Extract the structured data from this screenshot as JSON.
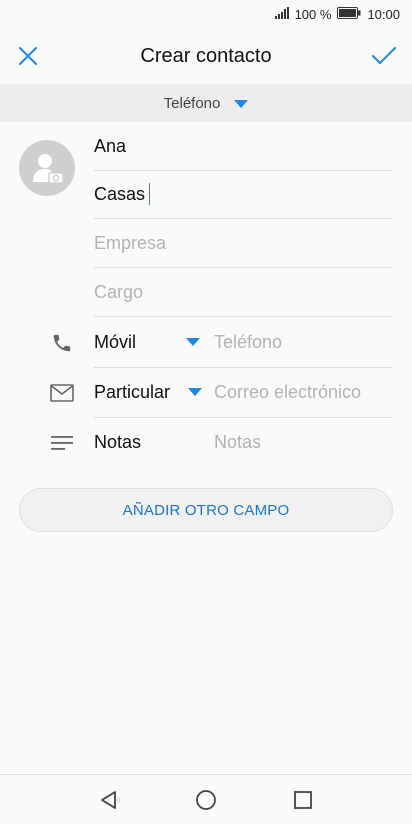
{
  "status_bar": {
    "battery_percent": "100 %",
    "time": "10:00"
  },
  "app_bar": {
    "title": "Crear contacto",
    "close_icon": "close-icon",
    "confirm_icon": "check-icon"
  },
  "account": {
    "label": "Teléfono"
  },
  "name": {
    "first": "Ana",
    "last": "Casas"
  },
  "company": {
    "placeholder": "Empresa"
  },
  "job_title": {
    "placeholder": "Cargo"
  },
  "phone": {
    "type": "Móvil",
    "placeholder": "Teléfono"
  },
  "email": {
    "type": "Particular",
    "placeholder": "Correo electrónico"
  },
  "notes": {
    "label": "Notas",
    "placeholder": "Notas"
  },
  "add_field_button": "AÑADIR OTRO CAMPO",
  "colors": {
    "accent": "#1e88e5",
    "divider": "#dcdcdc",
    "placeholder": "#b3b3b3"
  }
}
